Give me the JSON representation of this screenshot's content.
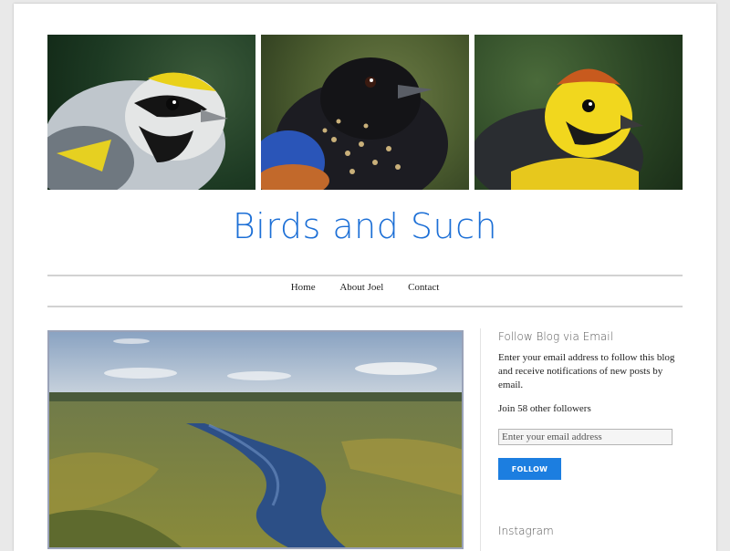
{
  "site": {
    "title": "Birds and Such"
  },
  "header_images": [
    {
      "name": "golden-winged-warbler-photo"
    },
    {
      "name": "black-bird-photo"
    },
    {
      "name": "yellow-black-bird-photo"
    }
  ],
  "nav": {
    "items": [
      {
        "label": "Home"
      },
      {
        "label": "About Joel"
      },
      {
        "label": "Contact"
      }
    ]
  },
  "sidebar": {
    "follow_widget": {
      "title": "Follow Blog via Email",
      "description": "Enter your email address to follow this blog and receive notifications of new posts by email.",
      "followers_text": "Join 58 other followers",
      "email_placeholder": "Enter your email address",
      "button_label": "Follow"
    },
    "instagram_widget": {
      "title": "Instagram"
    }
  },
  "colors": {
    "accent": "#1c6fd6",
    "button": "#1c7ee0",
    "rule": "#d2d2d2"
  }
}
